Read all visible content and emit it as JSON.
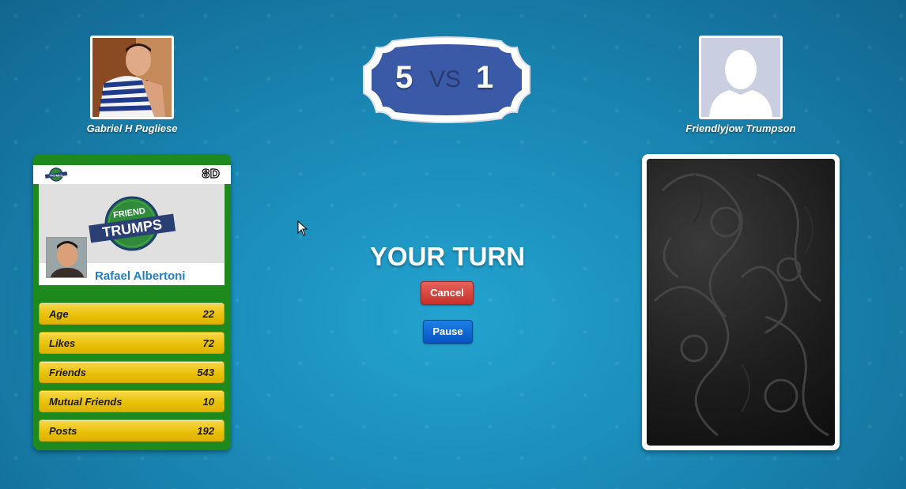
{
  "players": {
    "left": {
      "name": "Gabriel H Pugliese"
    },
    "right": {
      "name": "Friendlyjow Trumpson"
    }
  },
  "score": {
    "left": "5",
    "vs": "VS",
    "right": "1"
  },
  "card": {
    "id": "8D",
    "logo_top": "FRIEND",
    "logo_main": "TRUMPS",
    "mini_logo": "TRUMPS",
    "name": "Rafael Albertoni",
    "stats": [
      {
        "label": "Age",
        "value": "22"
      },
      {
        "label": "Likes",
        "value": "72"
      },
      {
        "label": "Friends",
        "value": "543"
      },
      {
        "label": "Mutual Friends",
        "value": "10"
      },
      {
        "label": "Posts",
        "value": "192"
      }
    ]
  },
  "center": {
    "turn_text": "YOUR TURN",
    "cancel_label": "Cancel",
    "pause_label": "Pause"
  },
  "colors": {
    "background": "#1a89b6",
    "card_green": "#1e8a1d",
    "stat_yellow": "#e9bf05",
    "score_blue": "#3a5aa8",
    "cancel_red": "#c8302a",
    "pause_blue": "#0654c2",
    "name_blue": "#1f7fc4"
  }
}
